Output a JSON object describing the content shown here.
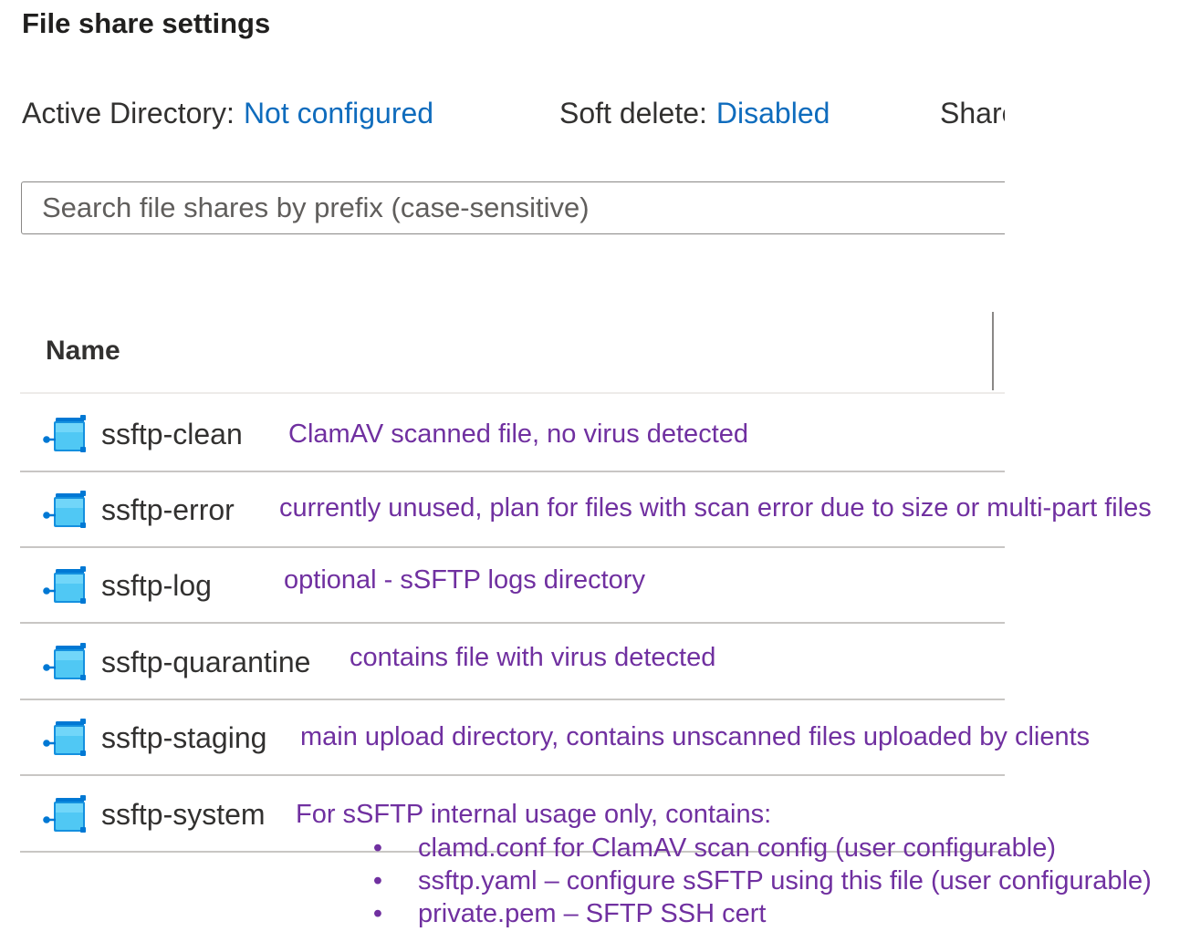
{
  "section": {
    "title": "File share settings"
  },
  "settings": {
    "active_directory": {
      "label": "Active Directory:",
      "value": "Not configured"
    },
    "soft_delete": {
      "label": "Soft delete:",
      "value": "Disabled"
    },
    "share_truncated": {
      "label": "Share"
    }
  },
  "search": {
    "placeholder": "Search file shares by prefix (case-sensitive)",
    "value": ""
  },
  "table": {
    "columns": [
      "Name"
    ],
    "rows": [
      {
        "name": "ssftp-clean",
        "icon": "file-share-icon"
      },
      {
        "name": "ssftp-error",
        "icon": "file-share-icon"
      },
      {
        "name": "ssftp-log",
        "icon": "file-share-icon"
      },
      {
        "name": "ssftp-quarantine",
        "icon": "file-share-icon"
      },
      {
        "name": "ssftp-staging",
        "icon": "file-share-icon"
      },
      {
        "name": "ssftp-system",
        "icon": "file-share-icon"
      }
    ]
  },
  "annotations": {
    "clean": "ClamAV scanned file, no virus detected",
    "error": "currently unused, plan for files with scan error due to size or multi-part files",
    "log": "optional - sSFTP logs directory",
    "quarantine": "contains file with virus detected",
    "staging": "main upload directory, contains unscanned files uploaded by clients",
    "system": {
      "intro": "For sSFTP internal usage only, contains:",
      "bullet": "•",
      "items": [
        "clamd.conf for ClamAV scan config (user configurable)",
        "ssftp.yaml – configure sSFTP using this file (user configurable)",
        "private.pem – SFTP SSH cert"
      ]
    }
  },
  "colors": {
    "link": "#0f6cbd",
    "annotation": "#7030a0",
    "icon_light": "#50e6ff",
    "icon_dark": "#0078d4"
  }
}
